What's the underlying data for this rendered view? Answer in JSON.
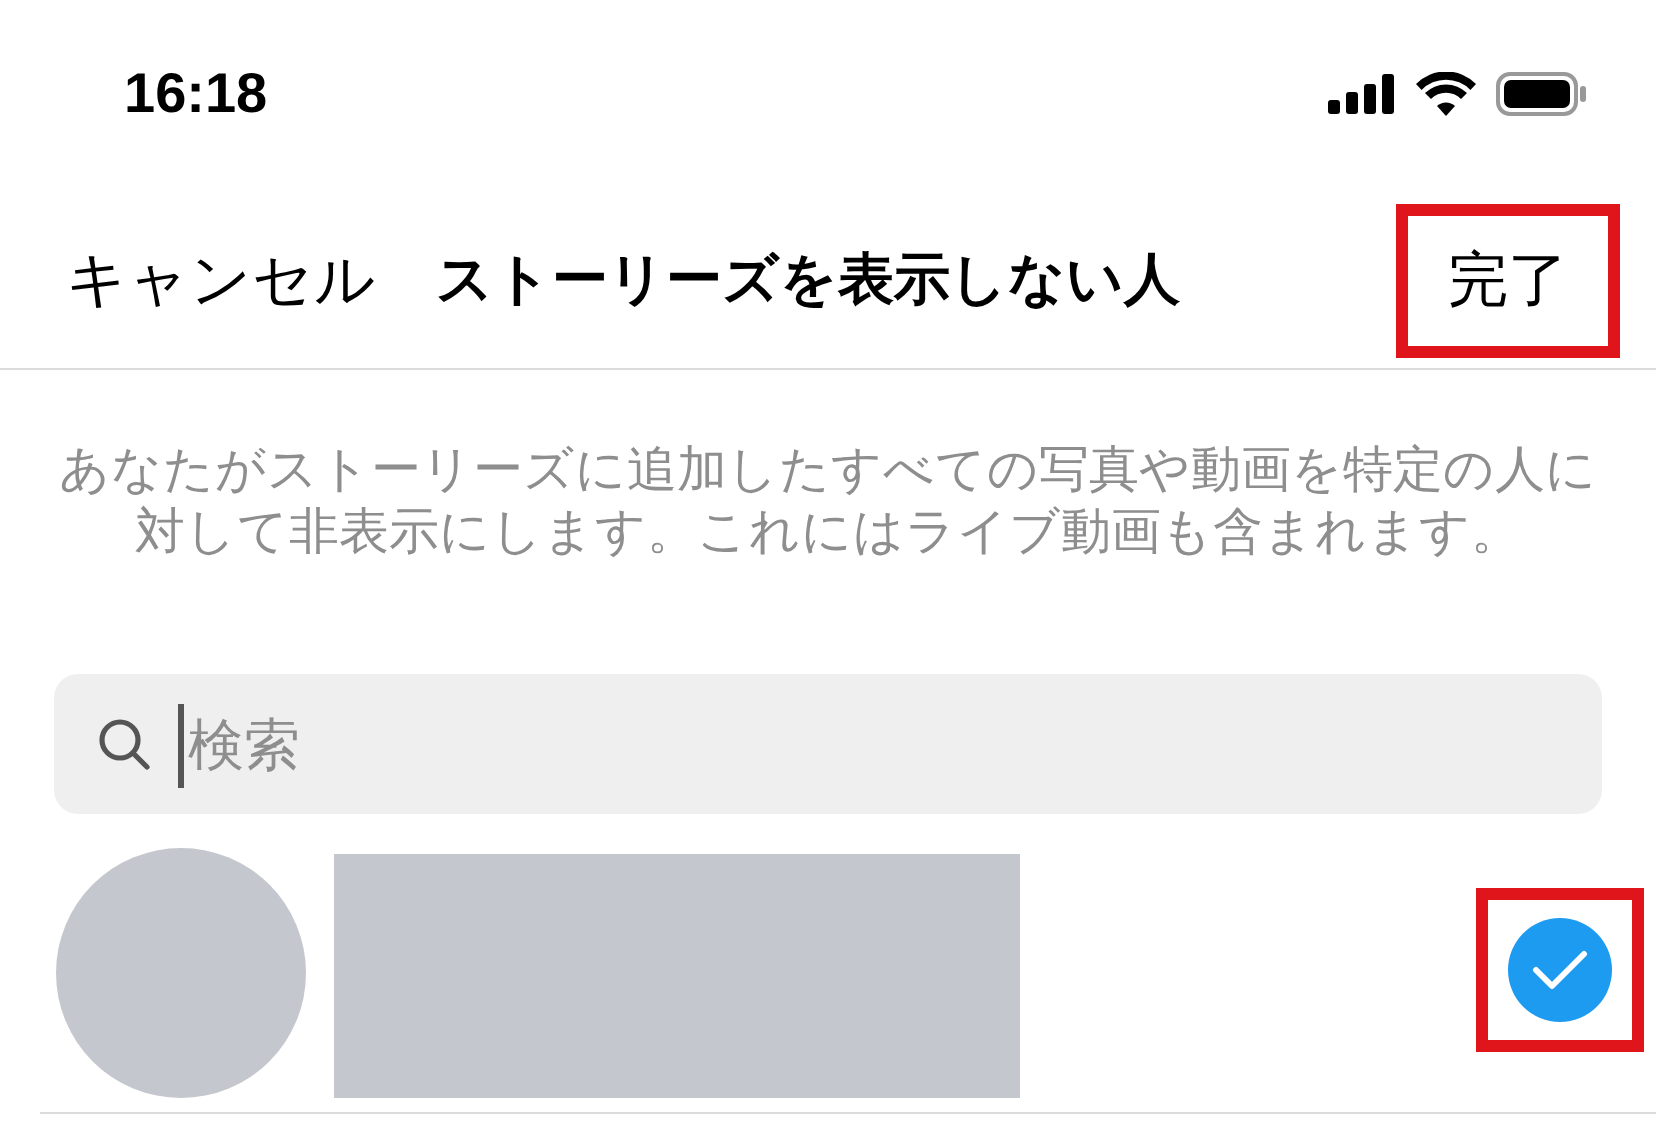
{
  "status_bar": {
    "time": "16:18"
  },
  "nav": {
    "cancel": "キャンセル",
    "title": "ストーリーズを表示しない人",
    "done": {
      "label": "完了",
      "highlighted": true
    }
  },
  "description": "あなたがストーリーズに追加したすべての写真や動画を特定の人に対して非表示にします。これにはライブ動画も含まれます。",
  "search": {
    "placeholder": "検索"
  },
  "people": [
    {
      "selected": true,
      "highlighted": true
    }
  ]
}
